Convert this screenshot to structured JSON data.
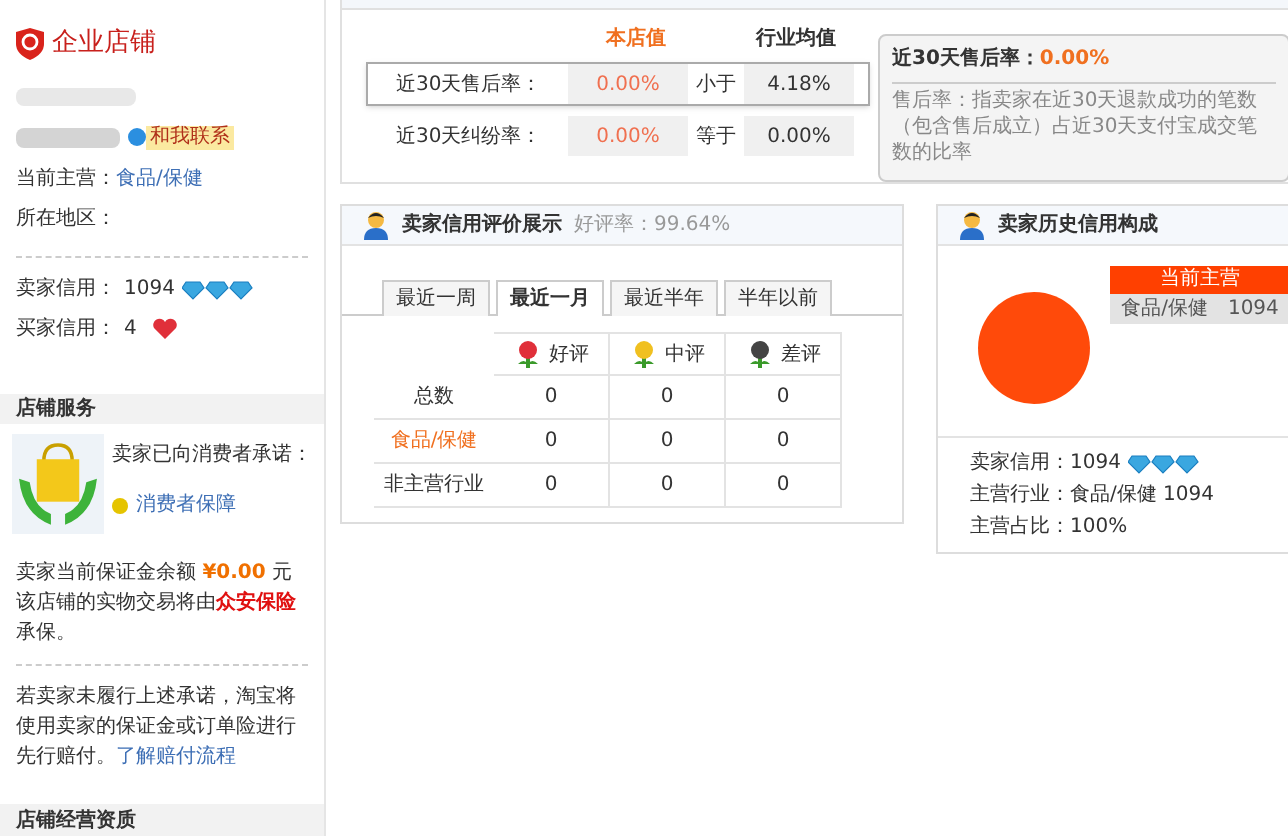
{
  "sidebar": {
    "shop_type": "企业店铺",
    "contact_badge": "和我联系",
    "main_business": {
      "label": "当前主营：",
      "value": "食品/保健"
    },
    "region": {
      "label": "所在地区："
    },
    "credits": [
      {
        "label": "卖家信用：",
        "value": "1094",
        "kind": "diamonds"
      },
      {
        "label": "买家信用：",
        "value": "4",
        "kind": "hearts"
      }
    ],
    "services": {
      "title": "店铺服务",
      "promise": "卖家已向消费者承诺：",
      "guarantee": "消费者保障",
      "deposit_prefix": "卖家当前保证金余额",
      "deposit_amount": "¥0.00",
      "deposit_suffix": "元",
      "insurance_prefix": "该店铺的实物交易将由",
      "insurer": "众安保险",
      "insurance_suffix": "承保。",
      "note": "若卖家未履行上述承诺，淘宝将使用卖家的保证金或订单险进行先行赔付。",
      "note_link": "了解赔付流程"
    },
    "qualification_title": "店铺经营资质"
  },
  "service_stats": {
    "columns": [
      "本店值",
      "行业均值"
    ],
    "rows": [
      {
        "label": "近30天售后率：",
        "value": "0.00%",
        "compare": "小于",
        "industry": "4.18%",
        "selected": true
      },
      {
        "label": "近30天纠纷率：",
        "value": "0.00%",
        "compare": "等于",
        "industry": "0.00%",
        "selected": false
      }
    ],
    "tip": {
      "title": "近30天售后率：",
      "value": "0.00%",
      "text": "售后率：指卖家在近30天退款成功的笔数（包含售后成立）占近30天支付宝成交笔数的比率"
    }
  },
  "rating_panel": {
    "title": "卖家信用评价展示",
    "rate": "好评率：99.64%",
    "tabs": [
      {
        "label": "最近一周",
        "selected": false
      },
      {
        "label": "最近一月",
        "selected": true
      },
      {
        "label": "最近半年",
        "selected": false
      },
      {
        "label": "半年以前",
        "selected": false
      }
    ],
    "columns": [
      {
        "label": "好评",
        "kind": "good"
      },
      {
        "label": "中评",
        "kind": "neutral"
      },
      {
        "label": "差评",
        "kind": "bad"
      }
    ],
    "rows": [
      {
        "label": "总数",
        "highlight": false,
        "values": [
          "0",
          "0",
          "0"
        ]
      },
      {
        "label": "食品/保健",
        "highlight": true,
        "values": [
          "0",
          "0",
          "0"
        ]
      },
      {
        "label": "非主营行业",
        "highlight": false,
        "values": [
          "0",
          "0",
          "0"
        ]
      }
    ]
  },
  "history_panel": {
    "title": "卖家历史信用构成",
    "legend_title": "当前主营",
    "legend_item": "食品/保健",
    "legend_value": "1094",
    "details": [
      {
        "label": "卖家信用：",
        "value": "1094",
        "kind": "diamonds"
      },
      {
        "label": "主营行业：",
        "value": "食品/保健 1094",
        "kind": "plain"
      },
      {
        "label": "主营占比：",
        "value": "100%",
        "kind": "plain"
      }
    ]
  }
}
